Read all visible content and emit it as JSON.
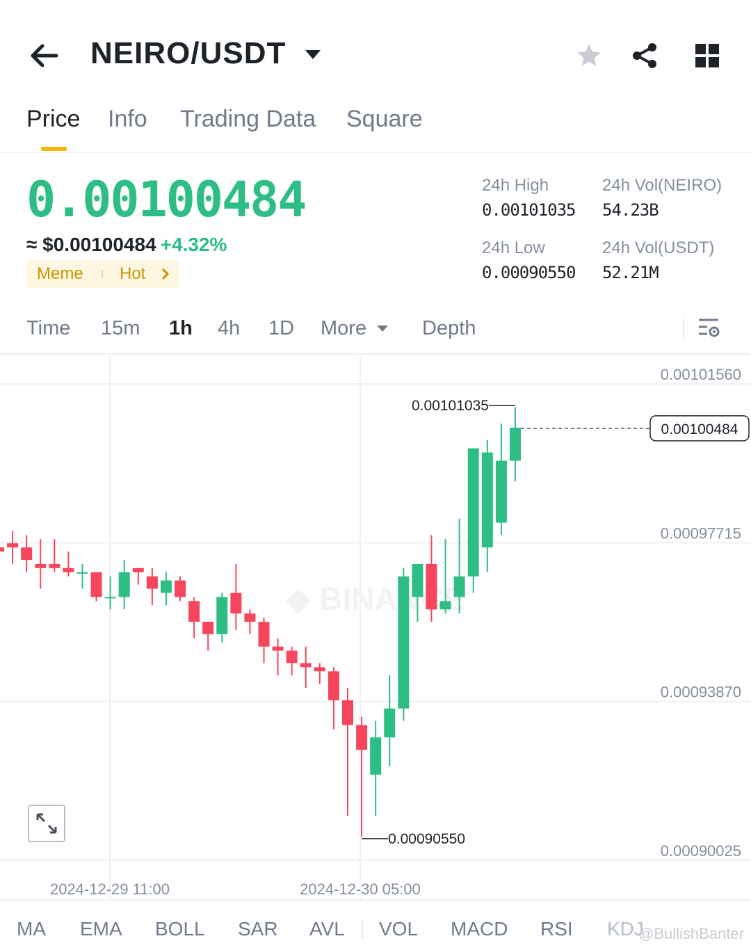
{
  "header": {
    "pair": "NEIRO/USDT",
    "icons": [
      "back-arrow-icon",
      "caret-down-icon",
      "star-icon",
      "share-icon",
      "grid-icon"
    ]
  },
  "tabs": [
    "Price",
    "Info",
    "Trading Data",
    "Square"
  ],
  "active_tab": "Price",
  "price": {
    "last": "0.00100484",
    "fiat": "≈ $0.00100484",
    "change": "+4.32%",
    "tags": [
      "Meme",
      "Hot"
    ]
  },
  "stats": {
    "high_label": "24h High",
    "high": "0.00101035",
    "low_label": "24h Low",
    "low": "0.00090550",
    "vol_base_label": "24h Vol(NEIRO)",
    "vol_base": "54.23B",
    "vol_quote_label": "24h Vol(USDT)",
    "vol_quote": "52.21M"
  },
  "timeframes": [
    "Time",
    "15m",
    "1h",
    "4h",
    "1D",
    "More",
    "Depth"
  ],
  "active_timeframe": "1h",
  "chart_data": {
    "type": "candlestick",
    "interval": "1h",
    "y_ticks": [
      "0.00101560",
      "0.00097715",
      "0.00093870",
      "0.00090025"
    ],
    "ylim": [
      0.00090025,
      0.0010156
    ],
    "x_ticks": [
      "2024-12-29 11:00",
      "2024-12-30 05:00"
    ],
    "high_marker": "0.00101035",
    "low_marker": "0.00090550",
    "last_price_label": "0.00100484",
    "candles": [
      {
        "o": 0.000976,
        "h": 0.00098,
        "l": 0.00097,
        "c": 0.000975
      },
      {
        "o": 0.000977,
        "h": 0.00098,
        "l": 0.000972,
        "c": 0.000976
      },
      {
        "o": 0.000976,
        "h": 0.000979,
        "l": 0.00097,
        "c": 0.000973
      },
      {
        "o": 0.000972,
        "h": 0.000978,
        "l": 0.000966,
        "c": 0.000971
      },
      {
        "o": 0.000972,
        "h": 0.000978,
        "l": 0.00097,
        "c": 0.000971
      },
      {
        "o": 0.000971,
        "h": 0.000975,
        "l": 0.000969,
        "c": 0.00097
      },
      {
        "o": 0.00097,
        "h": 0.000972,
        "l": 0.000966,
        "c": 0.00097
      },
      {
        "o": 0.00097,
        "h": 0.00097,
        "l": 0.000963,
        "c": 0.000964
      },
      {
        "o": 0.000964,
        "h": 0.000969,
        "l": 0.000961,
        "c": 0.000964
      },
      {
        "o": 0.000964,
        "h": 0.000973,
        "l": 0.000961,
        "c": 0.00097
      },
      {
        "o": 0.000971,
        "h": 0.000971,
        "l": 0.000967,
        "c": 0.00097
      },
      {
        "o": 0.000969,
        "h": 0.000971,
        "l": 0.000962,
        "c": 0.000966
      },
      {
        "o": 0.000965,
        "h": 0.00097,
        "l": 0.000962,
        "c": 0.000968
      },
      {
        "o": 0.000968,
        "h": 0.000969,
        "l": 0.000963,
        "c": 0.000964
      },
      {
        "o": 0.000963,
        "h": 0.000964,
        "l": 0.000954,
        "c": 0.000958
      },
      {
        "o": 0.000958,
        "h": 0.000958,
        "l": 0.000951,
        "c": 0.000955
      },
      {
        "o": 0.000955,
        "h": 0.000965,
        "l": 0.000953,
        "c": 0.000964
      },
      {
        "o": 0.000965,
        "h": 0.000972,
        "l": 0.000956,
        "c": 0.00096
      },
      {
        "o": 0.00096,
        "h": 0.000961,
        "l": 0.000955,
        "c": 0.000958
      },
      {
        "o": 0.000958,
        "h": 0.000959,
        "l": 0.000948,
        "c": 0.000952
      },
      {
        "o": 0.000952,
        "h": 0.000954,
        "l": 0.000945,
        "c": 0.000951
      },
      {
        "o": 0.000951,
        "h": 0.000952,
        "l": 0.000945,
        "c": 0.000948
      },
      {
        "o": 0.000948,
        "h": 0.000952,
        "l": 0.000942,
        "c": 0.000947
      },
      {
        "o": 0.000947,
        "h": 0.000948,
        "l": 0.000943,
        "c": 0.000946
      },
      {
        "o": 0.000946,
        "h": 0.000947,
        "l": 0.000932,
        "c": 0.000939
      },
      {
        "o": 0.000939,
        "h": 0.000942,
        "l": 0.000911,
        "c": 0.000933
      },
      {
        "o": 0.000933,
        "h": 0.000935,
        "l": 0.000906,
        "c": 0.000927
      },
      {
        "o": 0.000921,
        "h": 0.000934,
        "l": 0.000911,
        "c": 0.00093
      },
      {
        "o": 0.00093,
        "h": 0.000945,
        "l": 0.000923,
        "c": 0.000937
      },
      {
        "o": 0.000937,
        "h": 0.000971,
        "l": 0.000934,
        "c": 0.000969
      },
      {
        "o": 0.000964,
        "h": 0.000972,
        "l": 0.000958,
        "c": 0.000972
      },
      {
        "o": 0.000972,
        "h": 0.000979,
        "l": 0.000958,
        "c": 0.000961
      },
      {
        "o": 0.000961,
        "h": 0.000978,
        "l": 0.00096,
        "c": 0.000963
      },
      {
        "o": 0.000964,
        "h": 0.000983,
        "l": 0.00096,
        "c": 0.000969
      },
      {
        "o": 0.000969,
        "h": 0.001,
        "l": 0.000965,
        "c": 0.001
      },
      {
        "o": 0.000976,
        "h": 0.001002,
        "l": 0.00097,
        "c": 0.000999
      },
      {
        "o": 0.000982,
        "h": 0.001006,
        "l": 0.000979,
        "c": 0.000997
      },
      {
        "o": 0.000997,
        "h": 0.00101,
        "l": 0.000992,
        "c": 0.001005
      }
    ]
  },
  "expand_icon": "expand-icon",
  "settings_icon": "chart-settings-icon",
  "indicators": [
    "MA",
    "EMA",
    "BOLL",
    "SAR",
    "AVL",
    "VOL",
    "MACD",
    "RSI",
    "KDJ"
  ],
  "watermark": "@BullishBanter",
  "colors": {
    "up": "#2ebd85",
    "down": "#f6465d",
    "accent": "#f0b90b"
  }
}
